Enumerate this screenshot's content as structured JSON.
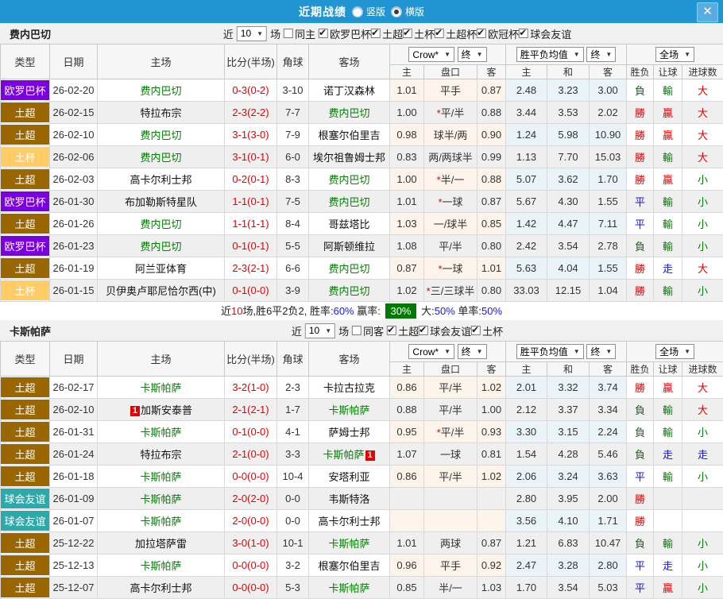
{
  "titlebar": {
    "title": "近期战绩",
    "radio_vertical": "竖版",
    "radio_horizontal": "横版",
    "close": "✕"
  },
  "ui": {
    "near": "近",
    "games": "场"
  },
  "colors": {
    "topbar": "#2095D2",
    "win_red": "#E60000",
    "lose_green": "#008000",
    "draw_blue": "#1414DC",
    "summary_badge_green": "#007A00"
  },
  "type_colors": {
    "欧罗巴杯": "#7B00E0",
    "土超": "#9A6600",
    "土杯": "#FFCC66",
    "球会友谊": "#2BAAAB"
  },
  "result_color_map": {
    "勝": "red",
    "負": "green",
    "平": "blue",
    "贏": "red",
    "輸": "green",
    "走": "blue",
    "大": "red",
    "小": "green"
  },
  "table_header": {
    "type": "类型",
    "date": "日期",
    "home": "主场",
    "score": "比分(半场)",
    "corner": "角球",
    "away": "客场",
    "crow_dd": "Crow*",
    "final_dd": "终",
    "avg_dd": "胜平负均值",
    "full_dd": "全场",
    "h": "主",
    "handicap": "盘口",
    "a": "客",
    "avg_h": "主",
    "avg_d": "和",
    "avg_a": "客",
    "wdl": "胜负",
    "let_goal": "让球",
    "goals": "进球数"
  },
  "sections": [
    {
      "team": "费内巴切",
      "filter": {
        "count": "10",
        "same_label": "同主",
        "same_checked": false,
        "leagues": [
          "欧罗巴杯",
          "土超",
          "土杯",
          "土超杯",
          "欧冠杯",
          "球会友谊"
        ]
      },
      "rows": [
        {
          "type": "欧罗巴杯",
          "date": "26-02-20",
          "home": "费内巴切",
          "homeGreen": true,
          "score": "0-3(0-2)",
          "corner": "3-10",
          "away": "诺丁汉森林",
          "awayGreen": false,
          "crowH": "1.01",
          "handicap": "平手",
          "star": false,
          "crowA": "0.87",
          "avgH": "2.48",
          "avgD": "3.23",
          "avgA": "3.00",
          "res": "負",
          "let": "輸",
          "goal": "大"
        },
        {
          "type": "土超",
          "date": "26-02-15",
          "home": "特拉布宗",
          "homeGreen": false,
          "score": "2-3(2-2)",
          "corner": "7-7",
          "away": "费内巴切",
          "awayGreen": true,
          "crowH": "1.00",
          "handicap": "平/半",
          "star": true,
          "crowA": "0.88",
          "avgH": "3.44",
          "avgD": "3.53",
          "avgA": "2.02",
          "res": "勝",
          "let": "贏",
          "goal": "大"
        },
        {
          "type": "土超",
          "date": "26-02-10",
          "home": "费内巴切",
          "homeGreen": true,
          "score": "3-1(3-0)",
          "corner": "7-9",
          "away": "根塞尔伯里吉",
          "awayGreen": false,
          "crowH": "0.98",
          "handicap": "球半/两",
          "star": false,
          "crowA": "0.90",
          "avgH": "1.24",
          "avgD": "5.98",
          "avgA": "10.90",
          "res": "勝",
          "let": "贏",
          "goal": "大"
        },
        {
          "type": "土杯",
          "date": "26-02-06",
          "home": "费内巴切",
          "homeGreen": true,
          "score": "3-1(0-1)",
          "corner": "6-0",
          "away": "埃尔祖鲁姆士邦",
          "awayGreen": false,
          "crowH": "0.83",
          "handicap": "两/两球半",
          "star": false,
          "crowA": "0.99",
          "avgH": "1.13",
          "avgD": "7.70",
          "avgA": "15.03",
          "res": "勝",
          "let": "輸",
          "goal": "大"
        },
        {
          "type": "土超",
          "date": "26-02-03",
          "home": "高卡尔利士邦",
          "homeGreen": false,
          "score": "0-2(0-1)",
          "corner": "8-3",
          "away": "费内巴切",
          "awayGreen": true,
          "crowH": "1.00",
          "handicap": "半/一",
          "star": true,
          "crowA": "0.88",
          "avgH": "5.07",
          "avgD": "3.62",
          "avgA": "1.70",
          "res": "勝",
          "let": "贏",
          "goal": "小"
        },
        {
          "type": "欧罗巴杯",
          "date": "26-01-30",
          "home": "布加勒斯特星队",
          "homeGreen": false,
          "score": "1-1(0-1)",
          "corner": "7-5",
          "away": "费内巴切",
          "awayGreen": true,
          "crowH": "1.01",
          "handicap": "一球",
          "star": true,
          "crowA": "0.87",
          "avgH": "5.67",
          "avgD": "4.30",
          "avgA": "1.55",
          "res": "平",
          "let": "輸",
          "goal": "小"
        },
        {
          "type": "土超",
          "date": "26-01-26",
          "home": "费内巴切",
          "homeGreen": true,
          "score": "1-1(1-1)",
          "corner": "8-4",
          "away": "哥兹塔比",
          "awayGreen": false,
          "crowH": "1.03",
          "handicap": "一/球半",
          "star": false,
          "crowA": "0.85",
          "avgH": "1.42",
          "avgD": "4.47",
          "avgA": "7.11",
          "res": "平",
          "let": "輸",
          "goal": "小"
        },
        {
          "type": "欧罗巴杯",
          "date": "26-01-23",
          "home": "费内巴切",
          "homeGreen": true,
          "score": "0-1(0-1)",
          "corner": "5-5",
          "away": "阿斯顿维拉",
          "awayGreen": false,
          "crowH": "1.08",
          "handicap": "平/半",
          "star": false,
          "crowA": "0.80",
          "avgH": "2.42",
          "avgD": "3.54",
          "avgA": "2.78",
          "res": "負",
          "let": "輸",
          "goal": "小"
        },
        {
          "type": "土超",
          "date": "26-01-19",
          "home": "阿兰亚体育",
          "homeGreen": false,
          "score": "2-3(2-1)",
          "corner": "6-6",
          "away": "费内巴切",
          "awayGreen": true,
          "crowH": "0.87",
          "handicap": "一球",
          "star": true,
          "crowA": "1.01",
          "avgH": "5.63",
          "avgD": "4.04",
          "avgA": "1.55",
          "res": "勝",
          "let": "走",
          "goal": "大"
        },
        {
          "type": "土杯",
          "date": "26-01-15",
          "home": "贝伊奥卢耶尼恰尔西(中)",
          "homeGreen": false,
          "score": "0-1(0-0)",
          "corner": "3-9",
          "away": "费内巴切",
          "awayGreen": true,
          "crowH": "1.02",
          "handicap": "三/三球半",
          "star": true,
          "crowA": "0.80",
          "avgH": "33.03",
          "avgD": "12.15",
          "avgA": "1.04",
          "res": "勝",
          "let": "輸",
          "goal": "小"
        }
      ],
      "summary": {
        "parts": [
          {
            "t": "近"
          },
          {
            "t": "10",
            "c": "red"
          },
          {
            "t": "场,胜6平2负2, 胜率:"
          },
          {
            "t": "60%",
            "c": "blue"
          },
          {
            "t": " 赢率: "
          },
          {
            "t": "30%",
            "badge": true
          },
          {
            "t": " 大:"
          },
          {
            "t": "50%",
            "c": "blue"
          },
          {
            "t": " 单率:"
          },
          {
            "t": "50%",
            "c": "blue"
          }
        ]
      }
    },
    {
      "team": "卡斯帕萨",
      "filter": {
        "count": "10",
        "same_label": "同客",
        "same_checked": false,
        "leagues": [
          "土超",
          "球会友谊",
          "土杯"
        ]
      },
      "rows": [
        {
          "type": "土超",
          "date": "26-02-17",
          "home": "卡斯帕萨",
          "homeGreen": true,
          "score": "3-2(1-0)",
          "corner": "2-3",
          "away": "卡拉古拉克",
          "awayGreen": false,
          "crowH": "0.86",
          "handicap": "平/半",
          "star": false,
          "crowA": "1.02",
          "avgH": "2.01",
          "avgD": "3.32",
          "avgA": "3.74",
          "res": "勝",
          "let": "贏",
          "goal": "大"
        },
        {
          "type": "土超",
          "date": "26-02-10",
          "home": "加斯安泰普",
          "homeGreen": false,
          "homeBadge": {
            "pos": "pre",
            "text": "1"
          },
          "score": "2-1(2-1)",
          "corner": "1-7",
          "away": "卡斯帕萨",
          "awayGreen": true,
          "crowH": "0.88",
          "handicap": "平/半",
          "star": false,
          "crowA": "1.00",
          "avgH": "2.12",
          "avgD": "3.37",
          "avgA": "3.34",
          "res": "負",
          "let": "輸",
          "goal": "大"
        },
        {
          "type": "土超",
          "date": "26-01-31",
          "home": "卡斯帕萨",
          "homeGreen": true,
          "score": "0-1(0-0)",
          "corner": "4-1",
          "away": "萨姆士邦",
          "awayGreen": false,
          "crowH": "0.95",
          "handicap": "平/半",
          "star": true,
          "crowA": "0.93",
          "avgH": "3.30",
          "avgD": "3.15",
          "avgA": "2.24",
          "res": "負",
          "let": "輸",
          "goal": "小"
        },
        {
          "type": "土超",
          "date": "26-01-24",
          "home": "特拉布宗",
          "homeGreen": false,
          "score": "2-1(0-0)",
          "corner": "3-3",
          "away": "卡斯帕萨",
          "awayGreen": true,
          "awayBadge": {
            "pos": "post",
            "text": "1"
          },
          "crowH": "1.07",
          "handicap": "一球",
          "star": false,
          "crowA": "0.81",
          "avgH": "1.54",
          "avgD": "4.28",
          "avgA": "5.46",
          "res": "負",
          "let": "走",
          "goal": "走"
        },
        {
          "type": "土超",
          "date": "26-01-18",
          "home": "卡斯帕萨",
          "homeGreen": true,
          "score": "0-0(0-0)",
          "corner": "10-4",
          "away": "安塔利亚",
          "awayGreen": false,
          "crowH": "0.86",
          "handicap": "平/半",
          "star": false,
          "crowA": "1.02",
          "avgH": "2.06",
          "avgD": "3.24",
          "avgA": "3.63",
          "res": "平",
          "let": "輸",
          "goal": "小"
        },
        {
          "type": "球会友谊",
          "date": "26-01-09",
          "home": "卡斯帕萨",
          "homeGreen": true,
          "score": "2-0(2-0)",
          "corner": "0-0",
          "away": "韦斯特洛",
          "awayGreen": false,
          "crowH": "",
          "handicap": "",
          "star": false,
          "crowA": "",
          "avgH": "2.80",
          "avgD": "3.95",
          "avgA": "2.00",
          "res": "勝",
          "let": "",
          "goal": ""
        },
        {
          "type": "球会友谊",
          "date": "26-01-07",
          "home": "卡斯帕萨",
          "homeGreen": true,
          "score": "2-0(0-0)",
          "corner": "0-0",
          "away": "高卡尔利士邦",
          "awayGreen": false,
          "crowH": "",
          "handicap": "",
          "star": false,
          "crowA": "",
          "avgH": "3.56",
          "avgD": "4.10",
          "avgA": "1.71",
          "res": "勝",
          "let": "",
          "goal": ""
        },
        {
          "type": "土超",
          "date": "25-12-22",
          "home": "加拉塔萨雷",
          "homeGreen": false,
          "score": "3-0(1-0)",
          "corner": "10-1",
          "away": "卡斯帕萨",
          "awayGreen": true,
          "crowH": "1.01",
          "handicap": "两球",
          "star": false,
          "crowA": "0.87",
          "avgH": "1.21",
          "avgD": "6.83",
          "avgA": "10.47",
          "res": "負",
          "let": "輸",
          "goal": "小"
        },
        {
          "type": "土超",
          "date": "25-12-13",
          "home": "卡斯帕萨",
          "homeGreen": true,
          "score": "0-0(0-0)",
          "corner": "3-2",
          "away": "根塞尔伯里吉",
          "awayGreen": false,
          "crowH": "0.96",
          "handicap": "平手",
          "star": false,
          "crowA": "0.92",
          "avgH": "2.47",
          "avgD": "3.28",
          "avgA": "2.80",
          "res": "平",
          "let": "走",
          "goal": "小"
        },
        {
          "type": "土超",
          "date": "25-12-07",
          "home": "高卡尔利士邦",
          "homeGreen": false,
          "score": "0-0(0-0)",
          "corner": "5-3",
          "away": "卡斯帕萨",
          "awayGreen": true,
          "crowH": "0.85",
          "handicap": "半/一",
          "star": false,
          "crowA": "1.03",
          "avgH": "1.70",
          "avgD": "3.54",
          "avgA": "5.03",
          "res": "平",
          "let": "贏",
          "goal": "小"
        }
      ],
      "summary": null
    }
  ]
}
